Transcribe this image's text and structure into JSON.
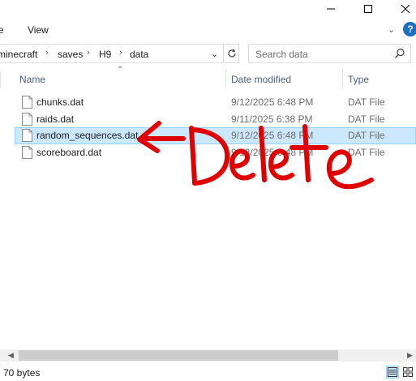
{
  "ribbon": {
    "home_tab": "e",
    "view_tab": "View",
    "help": "?"
  },
  "address": {
    "crumbs": [
      "minecraft",
      "saves",
      "H9",
      "data"
    ]
  },
  "search": {
    "placeholder": "Search data"
  },
  "columns": {
    "name": "Name",
    "date": "Date modified",
    "type": "Type"
  },
  "files": [
    {
      "name": "chunks.dat",
      "date": "9/12/2025 6:48 PM",
      "type": "DAT File",
      "selected": false
    },
    {
      "name": "raids.dat",
      "date": "9/11/2025 6:38 PM",
      "type": "DAT File",
      "selected": false
    },
    {
      "name": "random_sequences.dat",
      "date": "9/12/2025 6:48 PM",
      "type": "DAT File",
      "selected": true
    },
    {
      "name": "scoreboard.dat",
      "date": "9/12/2025 6:48 PM",
      "type": "DAT File",
      "selected": false
    }
  ],
  "status": {
    "size": "70 bytes"
  },
  "annotation": {
    "text": "Delete",
    "color": "#e00000"
  },
  "colors": {
    "selection_bg": "#cce8ff",
    "selection_border": "#99d1ff",
    "header_text": "#4c607a"
  }
}
